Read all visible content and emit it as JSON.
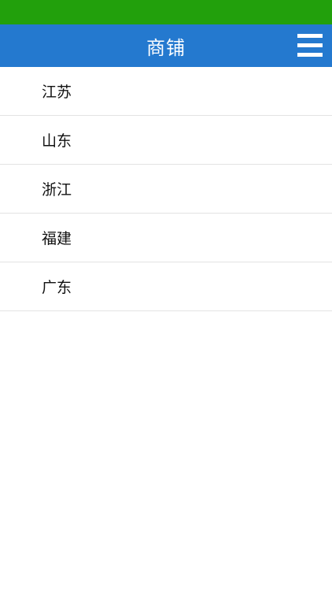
{
  "header": {
    "title": "商铺",
    "menu_icon": "hamburger-menu-icon"
  },
  "colors": {
    "status_bar": "#22a00c",
    "nav_bar": "#2479cf"
  },
  "provinces": [
    {
      "label": "江苏"
    },
    {
      "label": "山东"
    },
    {
      "label": "浙江"
    },
    {
      "label": "福建"
    },
    {
      "label": "广东"
    }
  ]
}
